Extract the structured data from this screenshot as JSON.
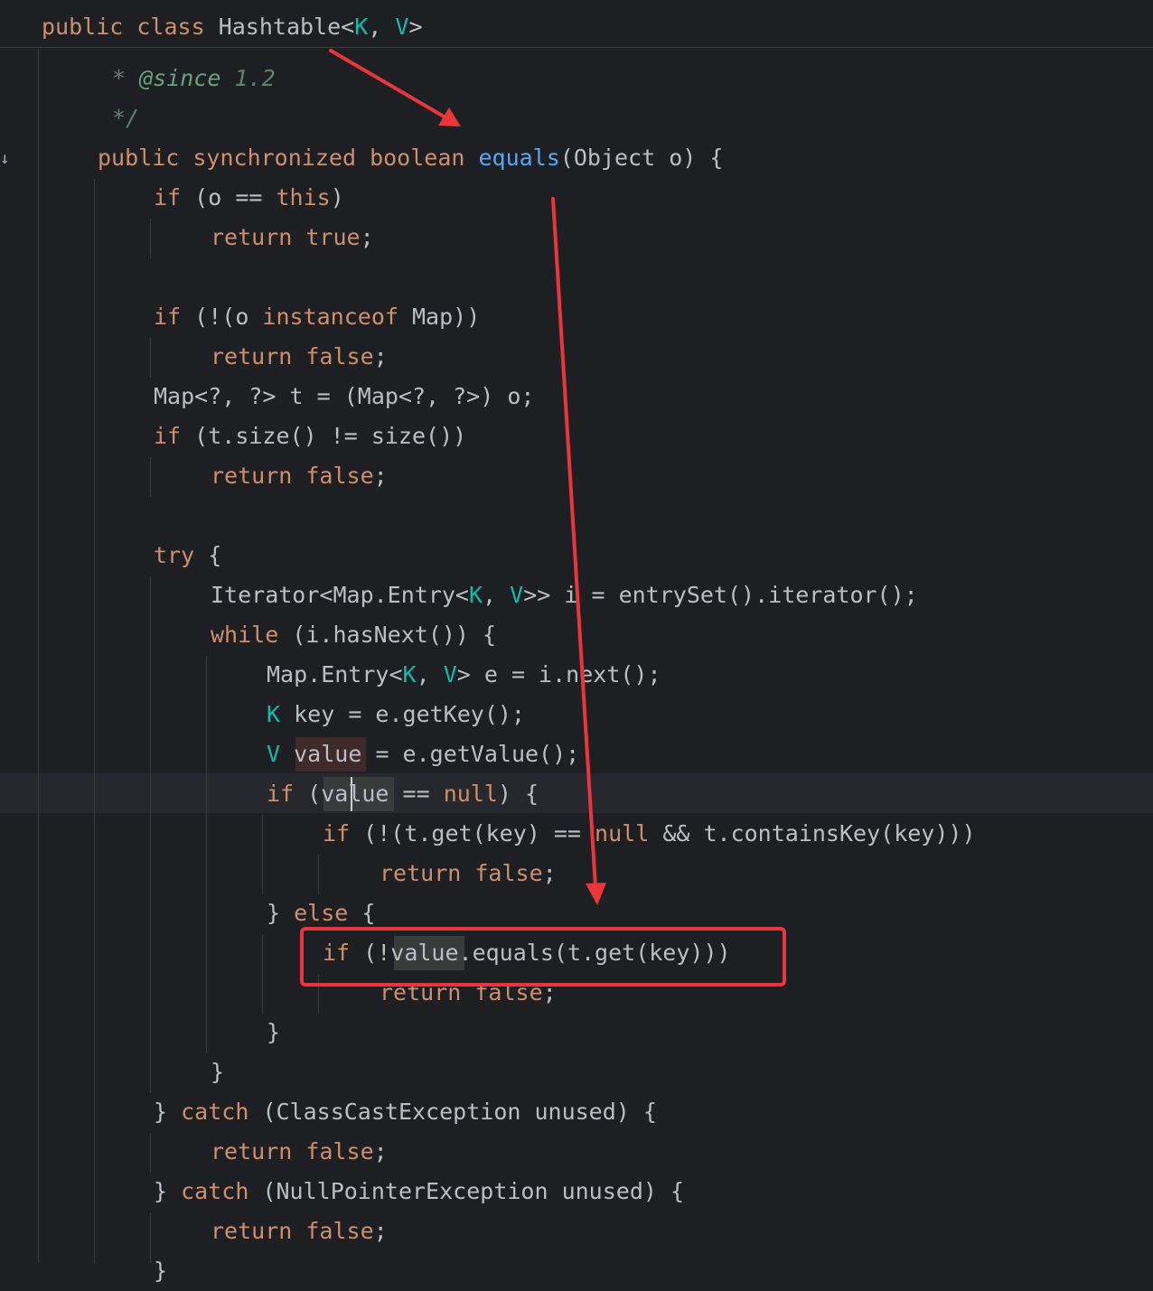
{
  "editor": {
    "sticky_header": {
      "kw_public": "public",
      "kw_class": "class",
      "class_name": "Hashtable<",
      "type_k": "K",
      "comma": ", ",
      "type_v": "V",
      "close": ">"
    },
    "lines": {
      "doc_since_star": "* ",
      "doc_since_tag": "@since",
      "doc_since_version": " 1.2",
      "doc_end": "*/",
      "method_public": "public",
      "method_synchronized": "synchronized",
      "method_boolean": "boolean",
      "method_name": "equals",
      "method_params": "(Object o) {",
      "if_kw": "if",
      "cond_this_open": " (o == ",
      "this_kw": "this",
      "close_paren": ")",
      "return_kw": "return",
      "true_kw": "true",
      "false_kw": "false",
      "semicolon": ";",
      "cond_instanceof_open": " (!(o ",
      "instanceof_kw": "instanceof",
      "cond_instanceof_close": " Map))",
      "map_cast": "Map<?, ?> t = (Map<?, ?>) o;",
      "cond_size": " (t.size() != size())",
      "try_kw": "try",
      "open_brace": " {",
      "iterator_head": "Iterator<Map.Entry<",
      "iterator_tail": ">> i = entrySet().iterator();",
      "while_kw": "while",
      "while_cond": " (i.hasNext()) {",
      "entry_head": "Map.Entry<",
      "entry_tail": "> e = i.next();",
      "type_k": "K",
      "type_v": "V",
      "comma": ", ",
      "key_decl": " key = e.getKey();",
      "value_var": "value",
      "value_assign": " = e.getValue();",
      "cond_value_open": " (",
      "null_kw": "null",
      "cond_value_close": ") {",
      "eq_op": " == ",
      "cond_get_open": " (!(t.get(key) == ",
      "cond_get_close": " && t.containsKey(key)))",
      "close_brace": "}",
      "else_kw": "else",
      "cond_equals_open": " (!",
      "cond_equals_close": ".equals(t.get(key)))",
      "catch_kw": "catch",
      "catch_cce": " (ClassCastException unused) {",
      "catch_npe": " (NullPointerException unused) {"
    }
  }
}
